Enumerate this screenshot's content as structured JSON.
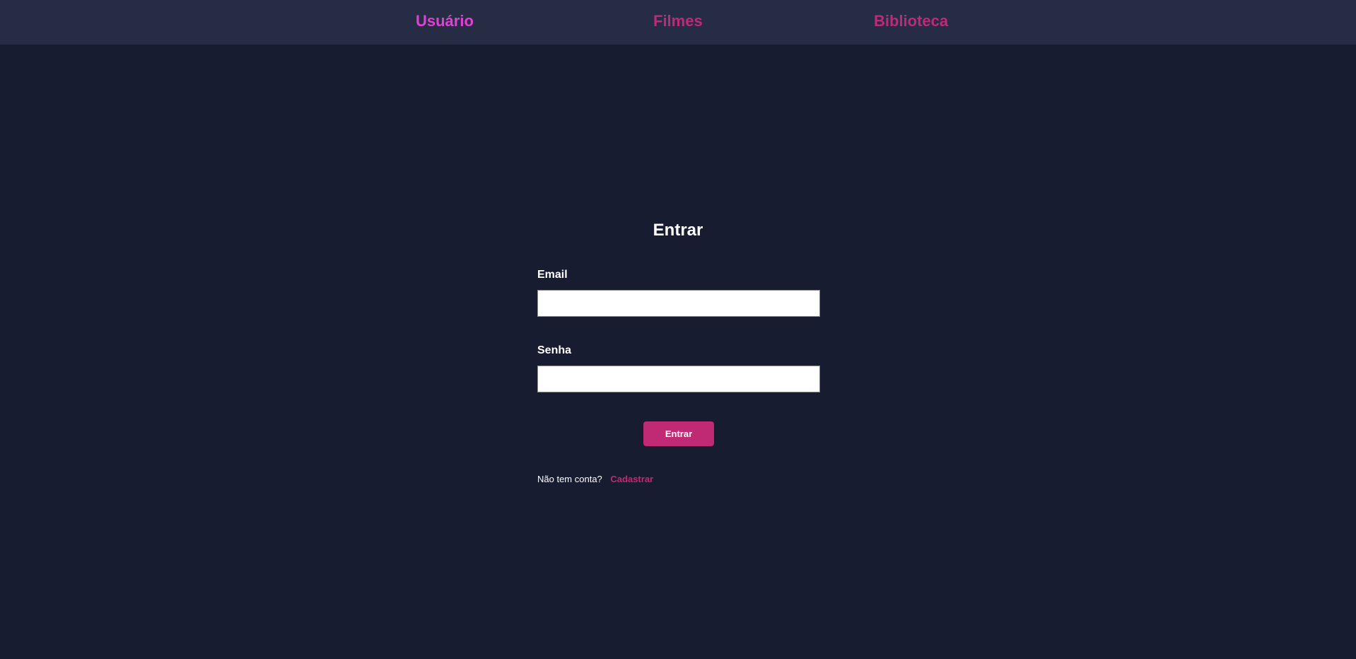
{
  "nav": {
    "items": [
      {
        "label": "Usuário",
        "color": "#e040d3",
        "active": true
      },
      {
        "label": "Filmes",
        "color": "#c02a74",
        "active": false
      },
      {
        "label": "Biblioteca",
        "color": "#c02a74",
        "active": false
      }
    ]
  },
  "form": {
    "title": "Entrar",
    "email_label": "Email",
    "email_value": "",
    "password_label": "Senha",
    "password_value": "",
    "submit_label": "Entrar"
  },
  "signup": {
    "prompt": "Não tem conta?",
    "link_label": "Cadastrar"
  },
  "colors": {
    "background": "#181c30",
    "navbar": "#272c45",
    "accent": "#c02a74",
    "active_nav": "#e040d3"
  }
}
